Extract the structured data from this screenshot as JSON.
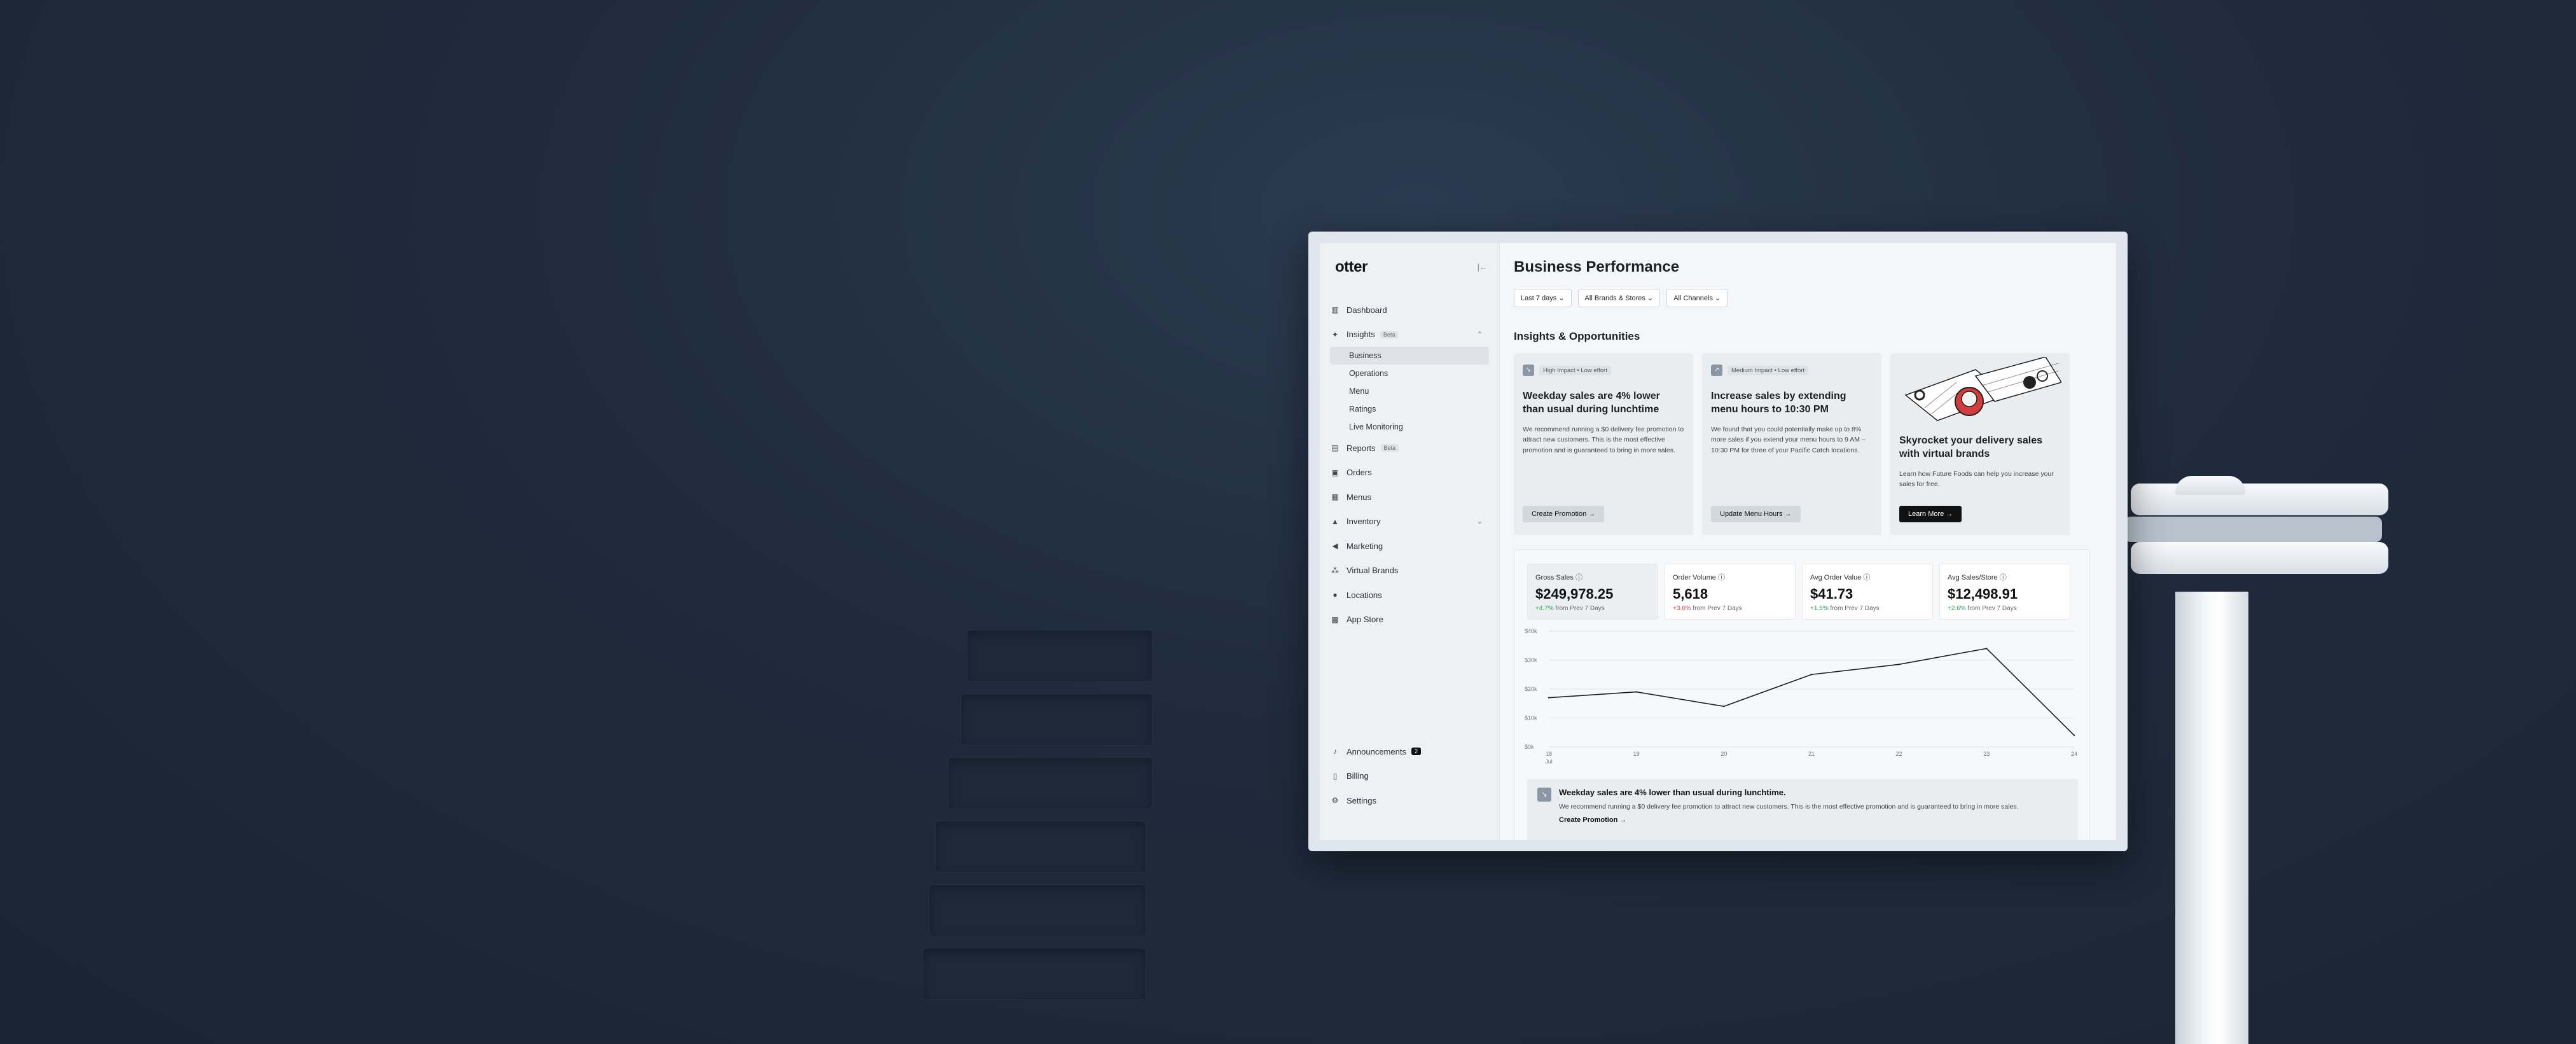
{
  "app": {
    "logo": "otter",
    "collapse_icon": "|←"
  },
  "sidebar": {
    "items": [
      {
        "label": "Dashboard",
        "icon": "chart-bars-icon"
      },
      {
        "label": "Insights",
        "badge": "Beta",
        "icon": "sparkle-icon"
      },
      {
        "label": "Reports",
        "badge": "Beta",
        "icon": "document-icon"
      },
      {
        "label": "Orders",
        "icon": "bag-icon"
      },
      {
        "label": "Menus",
        "icon": "book-icon"
      },
      {
        "label": "Inventory",
        "icon": "boxes-icon"
      },
      {
        "label": "Marketing",
        "icon": "megaphone-icon"
      },
      {
        "label": "Virtual Brands",
        "icon": "nodes-icon"
      },
      {
        "label": "Locations",
        "icon": "pin-icon"
      },
      {
        "label": "App Store",
        "icon": "grid-icon"
      }
    ],
    "insights_sub": [
      "Business",
      "Operations",
      "Menu",
      "Ratings",
      "Live Monitoring"
    ],
    "bottom": [
      {
        "label": "Announcements",
        "count": "2",
        "icon": "bell-icon"
      },
      {
        "label": "Billing",
        "icon": "receipt-icon"
      },
      {
        "label": "Settings",
        "icon": "gear-icon"
      }
    ]
  },
  "main": {
    "title": "Business Performance",
    "filters": [
      "Last 7 days",
      "All Brands & Stores",
      "All Channels"
    ],
    "section_title": "Insights & Opportunities",
    "cards": [
      {
        "tag": "High Impact • Low effort",
        "title": "Weekday sales are 4% lower than usual during lunchtime",
        "text": "We recommend running a $0 delivery fee promotion to attract new customers. This is the most effective promotion and is guaranteed to bring in more sales.",
        "button": "Create Promotion →"
      },
      {
        "tag": "Medium Impact • Low effort",
        "title": "Increase sales by extending menu hours to 10:30 PM",
        "text": "We found that you could potentially make up to 8% more sales if you extend your menu hours to 9 AM – 10:30 PM for three of your Pacific Catch locations.",
        "button": "Update Menu Hours →"
      },
      {
        "title": "Skyrocket your delivery sales with virtual brands",
        "text": "Learn how Future Foods can help you increase your sales for free.",
        "button": "Learn More →"
      }
    ],
    "metrics": [
      {
        "label": "Gross Sales",
        "value": "$249,978.25",
        "change": "+4.7%",
        "suffix": "from Prev 7 Days",
        "dir": "up"
      },
      {
        "label": "Order Volume",
        "value": "5,618",
        "change": "+3.6%",
        "suffix": "from Prev 7 Days",
        "dir": "down"
      },
      {
        "label": "Avg Order Value",
        "value": "$41.73",
        "change": "+1.5%",
        "suffix": "from Prev 7 Days",
        "dir": "up"
      },
      {
        "label": "Avg Sales/Store",
        "value": "$12,498.91",
        "change": "+2.6%",
        "suffix": "from Prev 7 Days",
        "dir": "up"
      }
    ],
    "bottom_insight": {
      "title": "Weekday sales are 4% lower than usual during lunchtime.",
      "text": "We recommend running a $0 delivery fee promotion to attract new customers. This is the most effective promotion and is guaranteed to bring in more sales.",
      "link": "Create Promotion →"
    }
  },
  "chart_data": {
    "type": "line",
    "x": [
      "18",
      "19",
      "20",
      "21",
      "22",
      "23",
      "24"
    ],
    "x_sub": "Jul",
    "yticks": [
      "$0k",
      "$10k",
      "$20k",
      "$30k",
      "$40k"
    ],
    "series": [
      {
        "values": [
          17,
          19,
          14,
          25,
          28.5,
          34,
          4
        ]
      }
    ],
    "ylim": [
      0,
      40
    ],
    "grid": true
  },
  "colors": {
    "accent": "#111111",
    "positive": "#2f9e4f",
    "negative": "#d43c3c"
  }
}
